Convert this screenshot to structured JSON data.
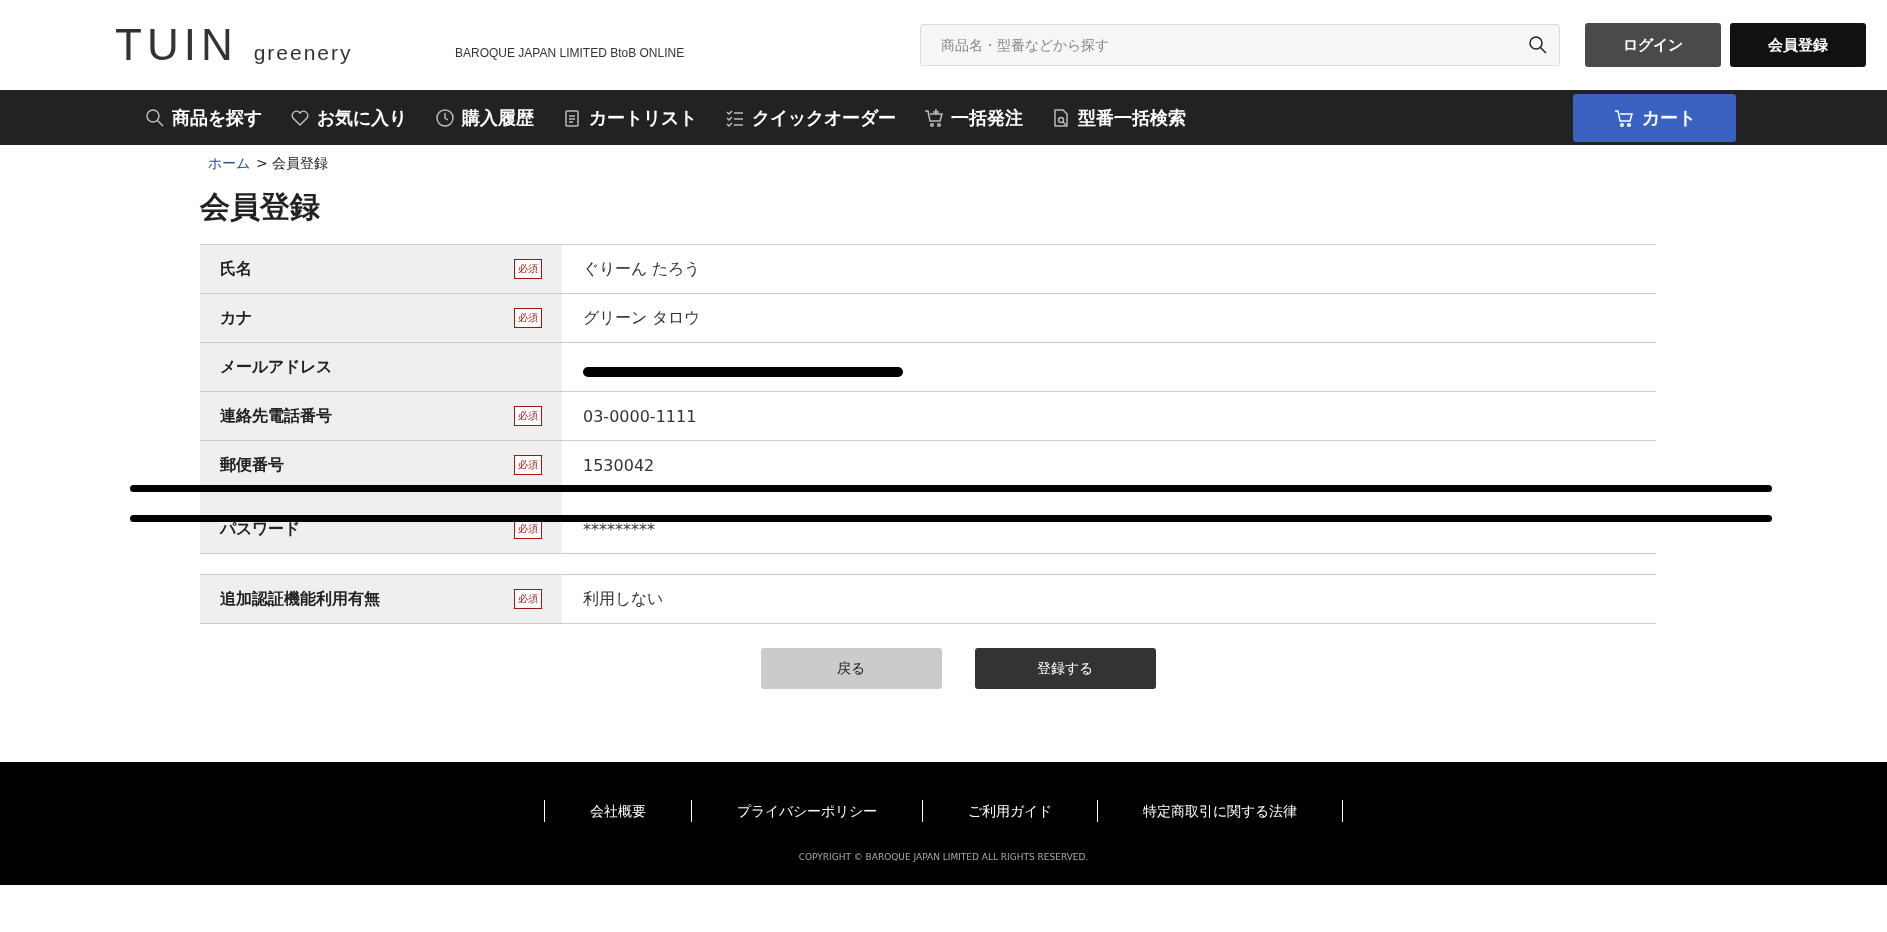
{
  "header": {
    "logo_main": "TUIN",
    "logo_sub": "greenery",
    "tagline": "BAROQUE JAPAN LIMITED BtoB ONLINE",
    "search": {
      "placeholder": "商品名・型番などから探す"
    },
    "buttons": [
      {
        "label": "ログイン",
        "kind": "grey"
      },
      {
        "label": "会員登録",
        "kind": "black"
      }
    ]
  },
  "nav": {
    "items": [
      {
        "label": "商品を探す"
      },
      {
        "label": "お気に入り"
      },
      {
        "label": "購入履歴"
      },
      {
        "label": "カートリスト"
      },
      {
        "label": "クイックオーダー"
      },
      {
        "label": "一括発注"
      },
      {
        "label": "型番一括検索"
      }
    ],
    "cart": "カート"
  },
  "breadcrumb": [
    {
      "label": "ホーム",
      "kind": "link"
    },
    {
      "label": "> 会員登録",
      "kind": "current"
    }
  ],
  "title": "会員登録",
  "form": {
    "rows": [
      {
        "kind": "field",
        "label": "氏名",
        "required_badge": "必須",
        "value": "ぐりーん たろう"
      },
      {
        "kind": "field",
        "label": "カナ",
        "required_badge": "必須",
        "value": "グリーン タロウ"
      },
      {
        "kind": "redacted",
        "label": "メールアドレス"
      },
      {
        "kind": "field",
        "label": "連絡先電話番号",
        "required_badge": "必須",
        "value": "03-0000-1111"
      },
      {
        "kind": "field",
        "label": "郵便番号",
        "required_badge": "必須",
        "value": "1530042"
      },
      {
        "kind": "hidden"
      },
      {
        "kind": "field",
        "label": "パスワード",
        "required_badge": "必須",
        "value": "*********"
      },
      {
        "kind": "spacer"
      },
      {
        "kind": "field",
        "label": "追加認証機能利用有無",
        "required_badge": "必須",
        "value": "利用しない"
      }
    ],
    "buttons": [
      {
        "label": "戻る",
        "kind": "back"
      },
      {
        "label": "登録する",
        "kind": "submit"
      }
    ]
  },
  "footer": {
    "links": [
      "会社概要",
      "プライバシーポリシー",
      "ご利用ガイド",
      "特定商取引に関する法律"
    ],
    "copyright": "COPYRIGHT © BAROQUE JAPAN LIMITED ALL RIGHTS RESERVED."
  }
}
